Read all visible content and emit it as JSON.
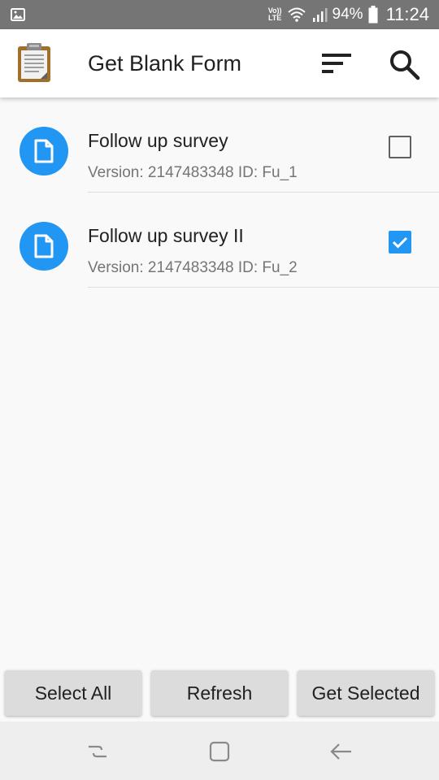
{
  "status_bar": {
    "network_label": "VoLTE",
    "battery_percent": "94%",
    "time": "11:24"
  },
  "app_bar": {
    "title": "Get Blank Form",
    "icons": [
      "clipboard-icon",
      "sort-icon",
      "search-icon"
    ]
  },
  "forms": [
    {
      "title": "Follow up survey",
      "subtitle": "Version: 2147483348 ID: Fu_1",
      "checked": false
    },
    {
      "title": "Follow up survey II",
      "subtitle": "Version: 2147483348 ID: Fu_2",
      "checked": true
    }
  ],
  "buttons": {
    "select_all": "Select All",
    "refresh": "Refresh",
    "get_selected": "Get Selected"
  },
  "colors": {
    "accent": "#2196f3",
    "status_bar": "#757575",
    "app_bar": "#ffffff",
    "button": "#dcdcdc"
  }
}
